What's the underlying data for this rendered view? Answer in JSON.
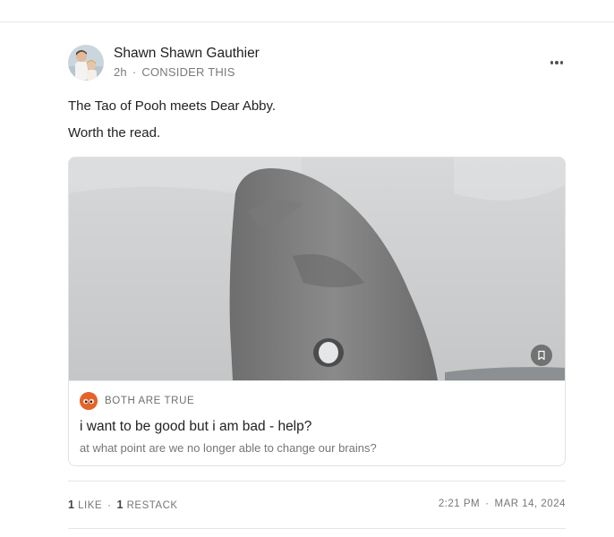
{
  "post": {
    "author": "Shawn Shawn Gauthier",
    "time": "2h",
    "separator": "·",
    "context": "CONSIDER THIS",
    "more_icon": "more-horizontal-icon",
    "paragraphs": [
      "The Tao of Pooh meets Dear Abby.",
      "Worth the read."
    ]
  },
  "card": {
    "publication": "BOTH ARE TRUE",
    "title": "i want to be good but i am bad - help?",
    "subtitle": "at what point are we no longer able to change our brains?",
    "bookmark_icon": "bookmark-icon"
  },
  "footer": {
    "likes_count": "1",
    "likes_label": "LIKE",
    "restacks_count": "1",
    "restacks_label": "RESTACK",
    "separator": "·",
    "time": "2:21 PM",
    "date": "MAR 14, 2024"
  },
  "colors": {
    "publication_icon": "#e3632a",
    "text_primary": "#222222",
    "text_secondary": "#777777",
    "divider": "#e6e6e6"
  }
}
